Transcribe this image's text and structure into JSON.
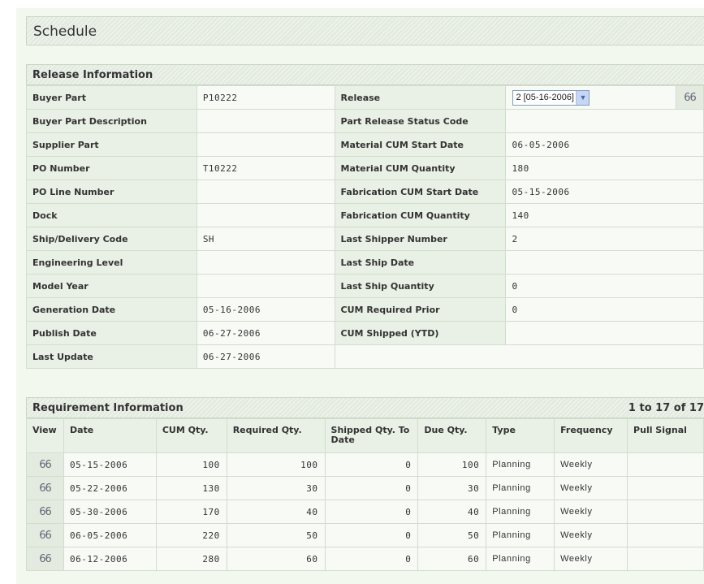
{
  "title": "Schedule",
  "release_section": {
    "header": "Release Information",
    "left": [
      {
        "label": "Buyer Part",
        "value": "P10222"
      },
      {
        "label": "Buyer Part Description",
        "value": ""
      },
      {
        "label": "Supplier Part",
        "value": ""
      },
      {
        "label": "PO Number",
        "value": "T10222"
      },
      {
        "label": "PO Line Number",
        "value": ""
      },
      {
        "label": "Dock",
        "value": ""
      },
      {
        "label": "Ship/Delivery Code",
        "value": "SH"
      },
      {
        "label": "Engineering Level",
        "value": ""
      },
      {
        "label": "Model Year",
        "value": ""
      },
      {
        "label": "Generation Date",
        "value": "05-16-2006"
      },
      {
        "label": "Publish Date",
        "value": "06-27-2006"
      },
      {
        "label": "Last Update",
        "value": "06-27-2006"
      }
    ],
    "right": [
      {
        "label": "Release",
        "value": "2 [05-16-2006]"
      },
      {
        "label": "Part Release Status Code",
        "value": ""
      },
      {
        "label": "Material CUM Start Date",
        "value": "06-05-2006"
      },
      {
        "label": "Material CUM Quantity",
        "value": "180"
      },
      {
        "label": "Fabrication CUM Start Date",
        "value": "05-15-2006"
      },
      {
        "label": "Fabrication CUM Quantity",
        "value": "140"
      },
      {
        "label": "Last Shipper Number",
        "value": "2"
      },
      {
        "label": "Last Ship Date",
        "value": ""
      },
      {
        "label": "Last Ship Quantity",
        "value": "0"
      },
      {
        "label": "CUM Required Prior",
        "value": "0"
      },
      {
        "label": "CUM Shipped (YTD)",
        "value": ""
      }
    ]
  },
  "requirement_section": {
    "header": "Requirement Information",
    "range": "1 to 17 of 17",
    "columns": [
      "View",
      "Date",
      "CUM Qty.",
      "Required Qty.",
      "Shipped Qty. To Date",
      "Due Qty.",
      "Type",
      "Frequency",
      "Pull Signal"
    ],
    "rows": [
      {
        "date": "05-15-2006",
        "cum": "100",
        "required": "100",
        "shipped": "0",
        "due": "100",
        "type": "Planning",
        "frequency": "Weekly",
        "pull": ""
      },
      {
        "date": "05-22-2006",
        "cum": "130",
        "required": "30",
        "shipped": "0",
        "due": "30",
        "type": "Planning",
        "frequency": "Weekly",
        "pull": ""
      },
      {
        "date": "05-30-2006",
        "cum": "170",
        "required": "40",
        "shipped": "0",
        "due": "40",
        "type": "Planning",
        "frequency": "Weekly",
        "pull": ""
      },
      {
        "date": "06-05-2006",
        "cum": "220",
        "required": "50",
        "shipped": "0",
        "due": "50",
        "type": "Planning",
        "frequency": "Weekly",
        "pull": ""
      },
      {
        "date": "06-12-2006",
        "cum": "280",
        "required": "60",
        "shipped": "0",
        "due": "60",
        "type": "Planning",
        "frequency": "Weekly",
        "pull": ""
      }
    ]
  },
  "icons": {
    "lookup": "eyeglasses-icon",
    "dropdown": "chevron-down-icon"
  },
  "colors": {
    "page_bg": "#f3f8ef",
    "header_bg": "#e3ebe0",
    "label_bg": "#e9f0e6",
    "border": "#d2ddce"
  }
}
